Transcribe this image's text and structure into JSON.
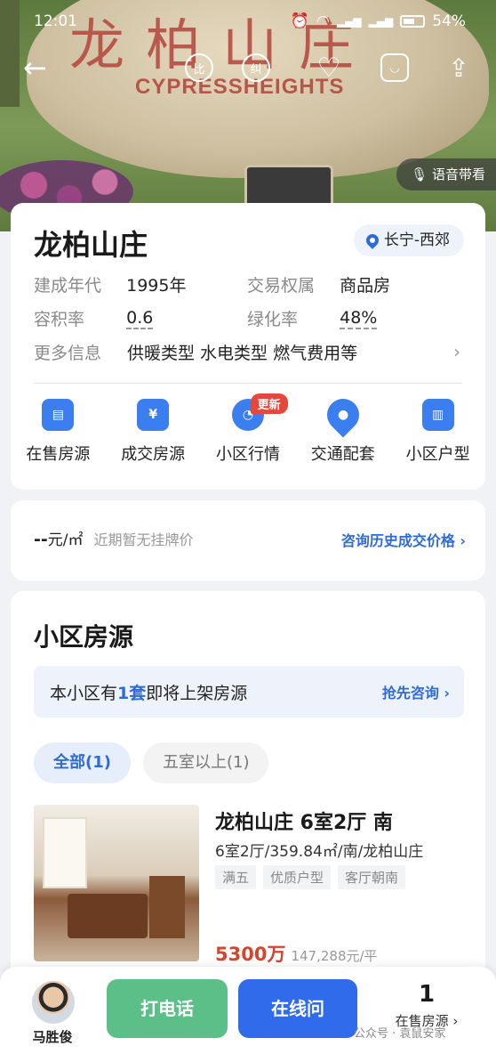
{
  "status_bar": {
    "time": "12:01",
    "signal_labels": "5G 5G",
    "battery": "54%"
  },
  "hero": {
    "carving_cn": "龙柏山庄",
    "carving_en": "CYPRESSHEIGHTS",
    "nav_icons": [
      "back-arrow-icon",
      "compare-icon",
      "report-icon",
      "heart-icon",
      "share-comment-icon",
      "share-icon"
    ],
    "compare_label": "比",
    "report_label": "纠",
    "voice_tour": "语音带看"
  },
  "overview": {
    "name": "龙柏山庄",
    "area_tag": "长宁-西郊",
    "rows": [
      {
        "label": "建成年代",
        "value": "1995年",
        "label2": "交易权属",
        "value2": "商品房"
      },
      {
        "label": "容积率",
        "value": "0.6",
        "label2": "绿化率",
        "value2": "48%"
      }
    ],
    "more": {
      "label": "更多信息",
      "value": "供暖类型 水电类型 燃气费用等"
    },
    "entries": [
      {
        "label": "在售房源",
        "icon": "listing-icon"
      },
      {
        "label": "成交房源",
        "icon": "yen-icon",
        "glyph": "¥"
      },
      {
        "label": "小区行情",
        "icon": "pie-chart-icon",
        "badge": "更新"
      },
      {
        "label": "交通配套",
        "icon": "location-pin-icon"
      },
      {
        "label": "小区户型",
        "icon": "floorplan-icon"
      }
    ]
  },
  "price": {
    "value": "--",
    "unit": "元/㎡",
    "note": "近期暂无挂牌价",
    "link": "咨询历史成交价格 ›"
  },
  "listings": {
    "title": "小区房源",
    "notice_pre": "本小区有",
    "notice_count": "1套",
    "notice_post": "即将上架房源",
    "notice_action": "抢先咨询 ›",
    "chips": [
      "全部(1)",
      "五室以上(1)"
    ],
    "item": {
      "title": "龙柏山庄 6室2厅 南",
      "sub": "6室2厅/359.84㎡/南/龙柏山庄",
      "tags": [
        "满五",
        "优质户型",
        "客厅朝南"
      ],
      "price": "5300万",
      "unit_price": "147,288元/平"
    }
  },
  "bottom": {
    "agent_name": "马胜俊",
    "call": "打电话",
    "online": "在线问",
    "forsale_count": "1",
    "forsale_label": "在售房源 ›"
  },
  "watermark": "公众号 · 袁鼠安家",
  "colors": {
    "accent": "#2f6bd8",
    "call": "#5bbf87",
    "online": "#2f6bea",
    "price": "#d2462f"
  }
}
